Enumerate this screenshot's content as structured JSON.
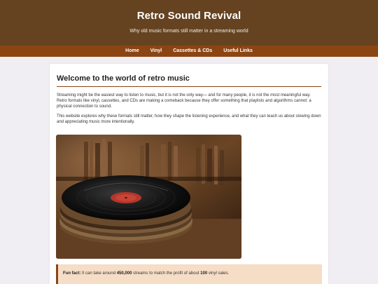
{
  "header": {
    "title": "Retro Sound Revival",
    "subtitle": "Why old music formats still matter in a streaming world"
  },
  "nav": {
    "items": [
      {
        "label": "Home"
      },
      {
        "label": "Vinyl"
      },
      {
        "label": "Cassettes & CDs"
      },
      {
        "label": "Useful Links"
      }
    ]
  },
  "main": {
    "heading": "Welcome to the world of retro music",
    "paragraphs": [
      "Streaming might be the easiest way to listen to music, but it is not the only way— and for many people, it is not the most meaningful way. Retro formats like vinyl, cassettes, and CDs are making a comeback because they offer something that playlists and algorithms cannot: a physical connection to sound.",
      "This website explores why these formats still matter, how they shape the listening experience, and what they can teach us about slowing down and appreciating music more intentionally."
    ],
    "image": {
      "subject": "stack of vinyl records on a wooden shelf"
    },
    "fun_fact": {
      "label": "Fun fact:",
      "text_before": " It can take around ",
      "streams": "450,000",
      "text_middle": " streams to match the profit of about ",
      "records": "100",
      "text_after": " vinyl sales."
    }
  },
  "colors": {
    "header_bg": "#654321",
    "nav_bg": "#8b4513",
    "page_bg": "#f1eef3",
    "fun_fact_bg": "#f6ddc6"
  }
}
